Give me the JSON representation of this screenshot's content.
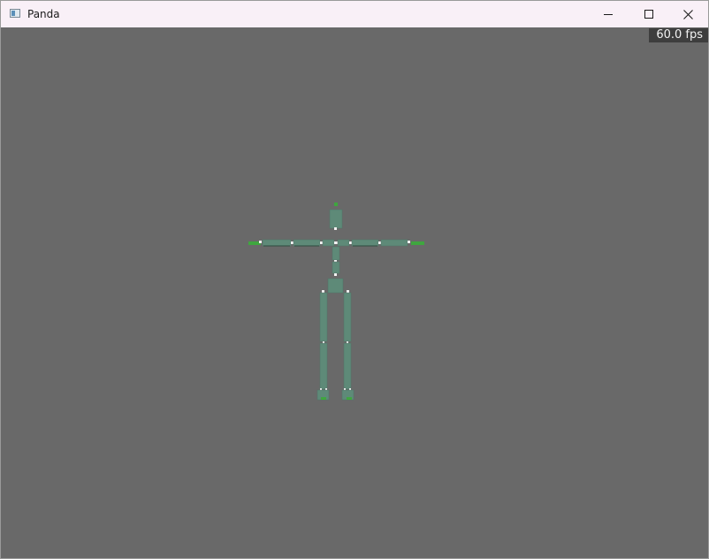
{
  "window": {
    "title": "Panda",
    "icon": "panda-app-icon"
  },
  "controls": {
    "minimize_icon": "minimize-icon",
    "maximize_icon": "maximize-icon",
    "close_icon": "close-icon"
  },
  "viewport": {
    "background_color": "#696969",
    "fps_label": "60.0 fps",
    "bone_color": "#5e8a78",
    "joint_color": "#f2f2f2",
    "end_marker_color": "#3fa63f"
  }
}
